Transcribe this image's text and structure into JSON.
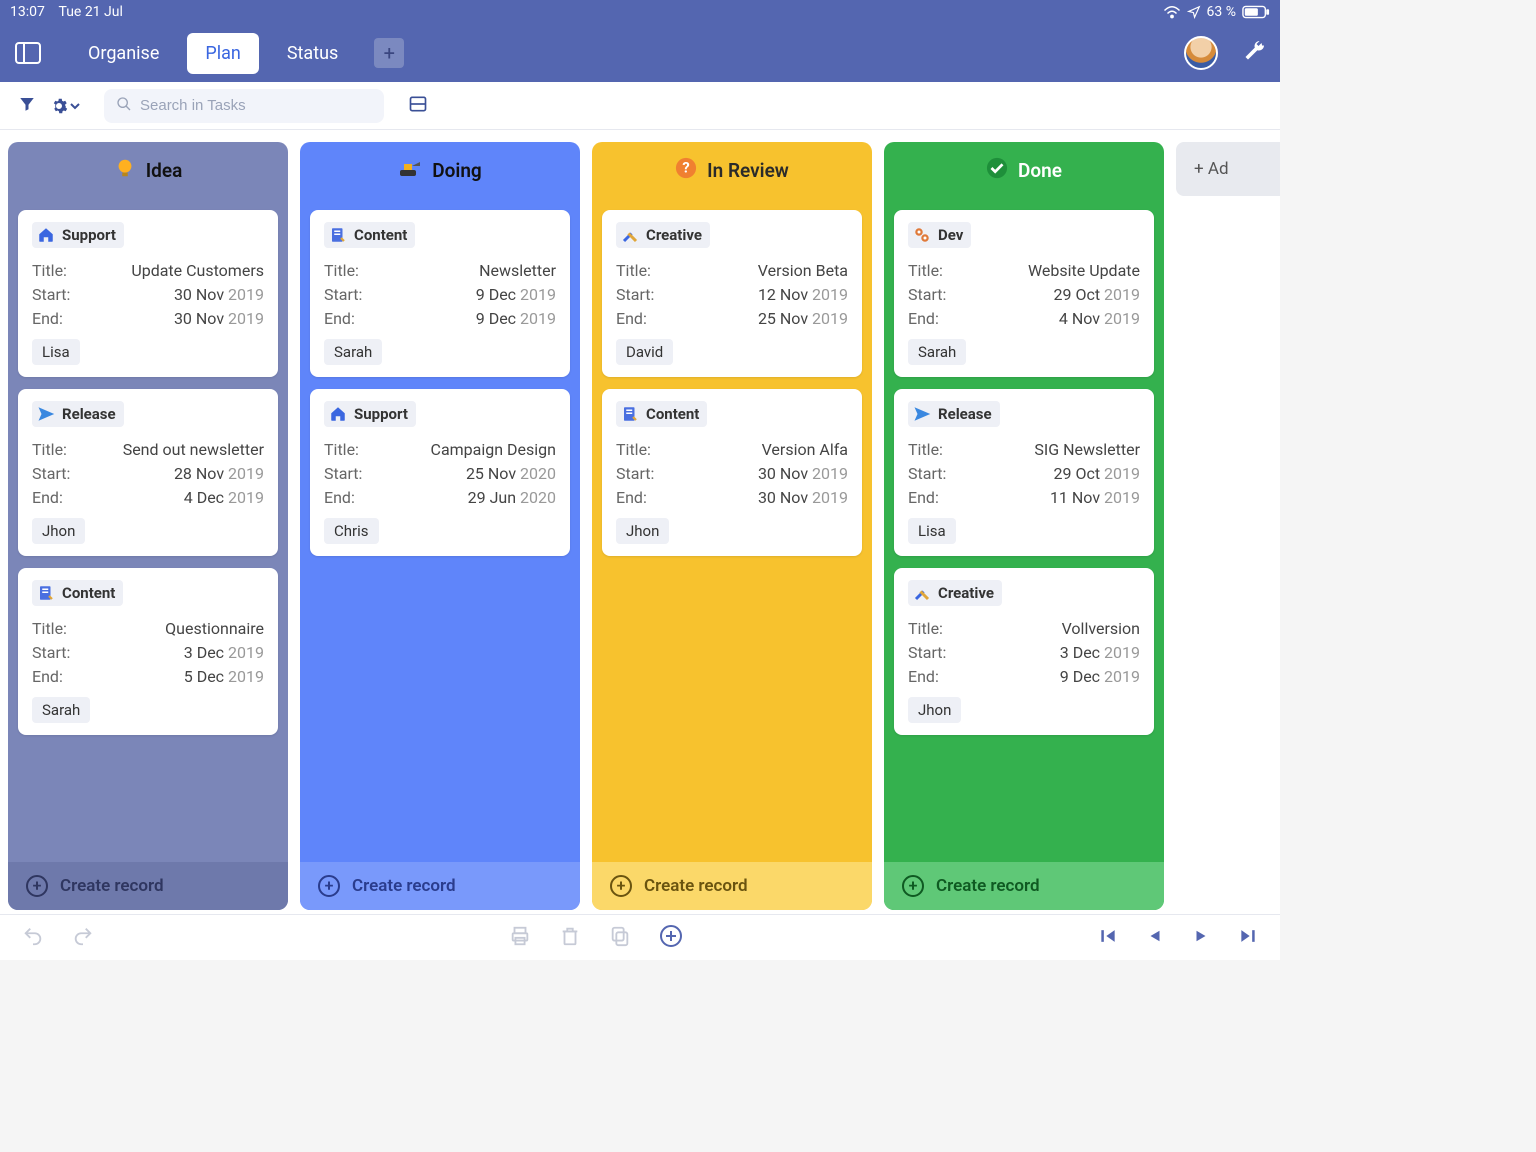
{
  "status_bar": {
    "time": "13:07",
    "date": "Tue 21 Jul",
    "battery": "63 %"
  },
  "tabs": {
    "organise": "Organise",
    "plan": "Plan",
    "status": "Status"
  },
  "toolbar": {
    "search_placeholder": "Search in Tasks"
  },
  "labels": {
    "title": "Title:",
    "start": "Start:",
    "end": "End:",
    "create": "Create record",
    "add_col": "+ Ad"
  },
  "categories": {
    "support": {
      "label": "Support",
      "icon": "house"
    },
    "release": {
      "label": "Release",
      "icon": "send"
    },
    "content": {
      "label": "Content",
      "icon": "doc"
    },
    "creative": {
      "label": "Creative",
      "icon": "tools"
    },
    "dev": {
      "label": "Dev",
      "icon": "gears"
    }
  },
  "columns": [
    {
      "key": "idea",
      "title": "Idea",
      "cls": "c-idea",
      "icon": "bulb",
      "cards": [
        {
          "cat": "support",
          "title": "Update Customers",
          "start": "30 Nov 2019",
          "end": "30 Nov 2019",
          "assignee": "Lisa"
        },
        {
          "cat": "release",
          "title": "Send out newsletter",
          "start": "28 Nov 2019",
          "end": "4 Dec 2019",
          "assignee": "Jhon"
        },
        {
          "cat": "content",
          "title": "Questionnaire",
          "start": "3 Dec 2019",
          "end": "5 Dec 2019",
          "assignee": "Sarah"
        }
      ]
    },
    {
      "key": "doing",
      "title": "Doing",
      "cls": "c-doing",
      "icon": "dig",
      "cards": [
        {
          "cat": "content",
          "title": "Newsletter",
          "start": "9 Dec 2019",
          "end": "9 Dec 2019",
          "assignee": "Sarah"
        },
        {
          "cat": "support",
          "title": "Campaign Design",
          "start": "25 Nov 2020",
          "end": "29 Jun 2020",
          "assignee": "Chris"
        }
      ]
    },
    {
      "key": "review",
      "title": "In Review",
      "cls": "c-review",
      "icon": "question",
      "cards": [
        {
          "cat": "creative",
          "title": "Version Beta",
          "start": "12 Nov 2019",
          "end": "25 Nov 2019",
          "assignee": "David"
        },
        {
          "cat": "content",
          "title": "Version Alfa",
          "start": "30 Nov 2019",
          "end": "30 Nov 2019",
          "assignee": "Jhon"
        }
      ]
    },
    {
      "key": "done",
      "title": "Done",
      "cls": "c-done",
      "icon": "check",
      "cards": [
        {
          "cat": "dev",
          "title": "Website Update",
          "start": "29 Oct 2019",
          "end": "4 Nov 2019",
          "assignee": "Sarah"
        },
        {
          "cat": "release",
          "title": "SIG Newsletter",
          "start": "29 Oct 2019",
          "end": "11 Nov 2019",
          "assignee": "Lisa"
        },
        {
          "cat": "creative",
          "title": "Vollversion",
          "start": "3 Dec 2019",
          "end": "9 Dec 2019",
          "assignee": "Jhon"
        }
      ]
    }
  ]
}
